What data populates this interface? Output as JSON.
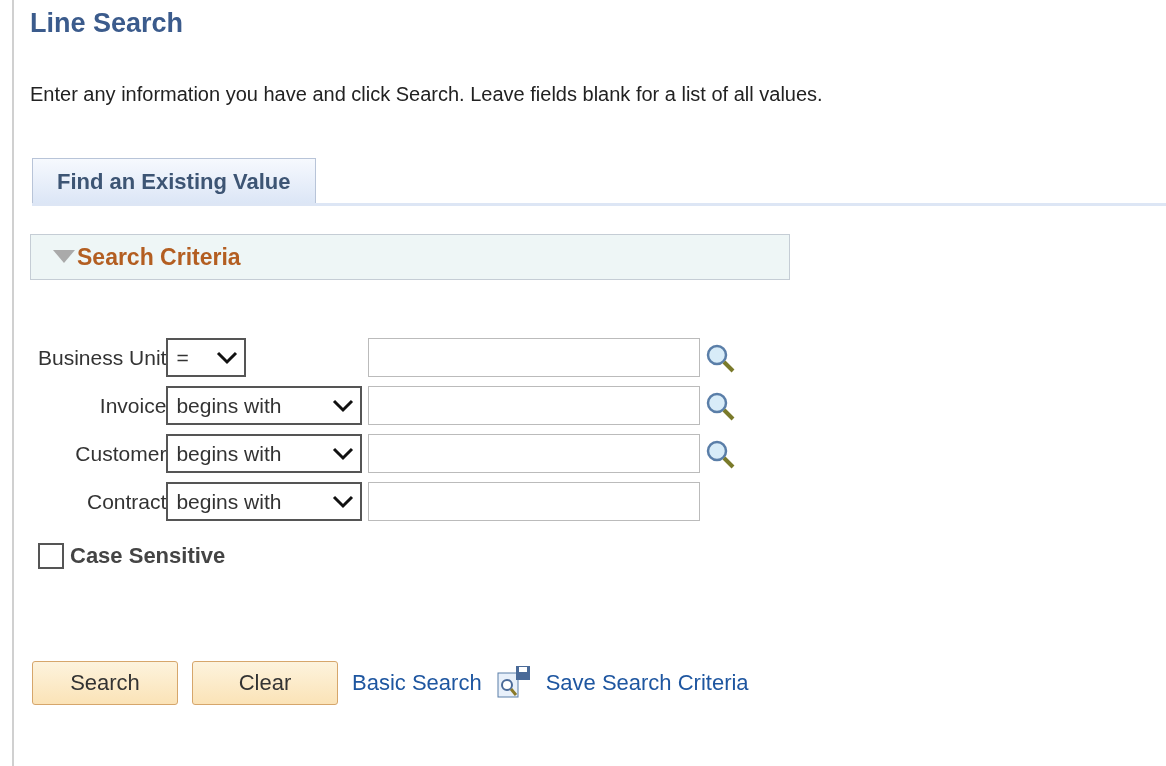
{
  "title": "Line Search",
  "instructions": "Enter any information you have and click Search. Leave fields blank for a list of all values.",
  "tabs": [
    {
      "label": "Find an Existing Value",
      "selected": true
    }
  ],
  "section": {
    "title": "Search Criteria",
    "expanded": true
  },
  "fields": [
    {
      "label": "Business Unit",
      "operator": "=",
      "lookup": true
    },
    {
      "label": "Invoice",
      "operator": "begins with",
      "lookup": true
    },
    {
      "label": "Customer",
      "operator": "begins with",
      "lookup": true
    },
    {
      "label": "Contract",
      "operator": "begins with",
      "lookup": false
    }
  ],
  "case_sensitive": {
    "label": "Case Sensitive",
    "checked": false
  },
  "buttons": [
    "Search",
    "Clear"
  ],
  "links": [
    {
      "label": "Basic Search",
      "kind": "plain"
    },
    {
      "label": "Save Search Criteria",
      "kind": "save"
    }
  ]
}
